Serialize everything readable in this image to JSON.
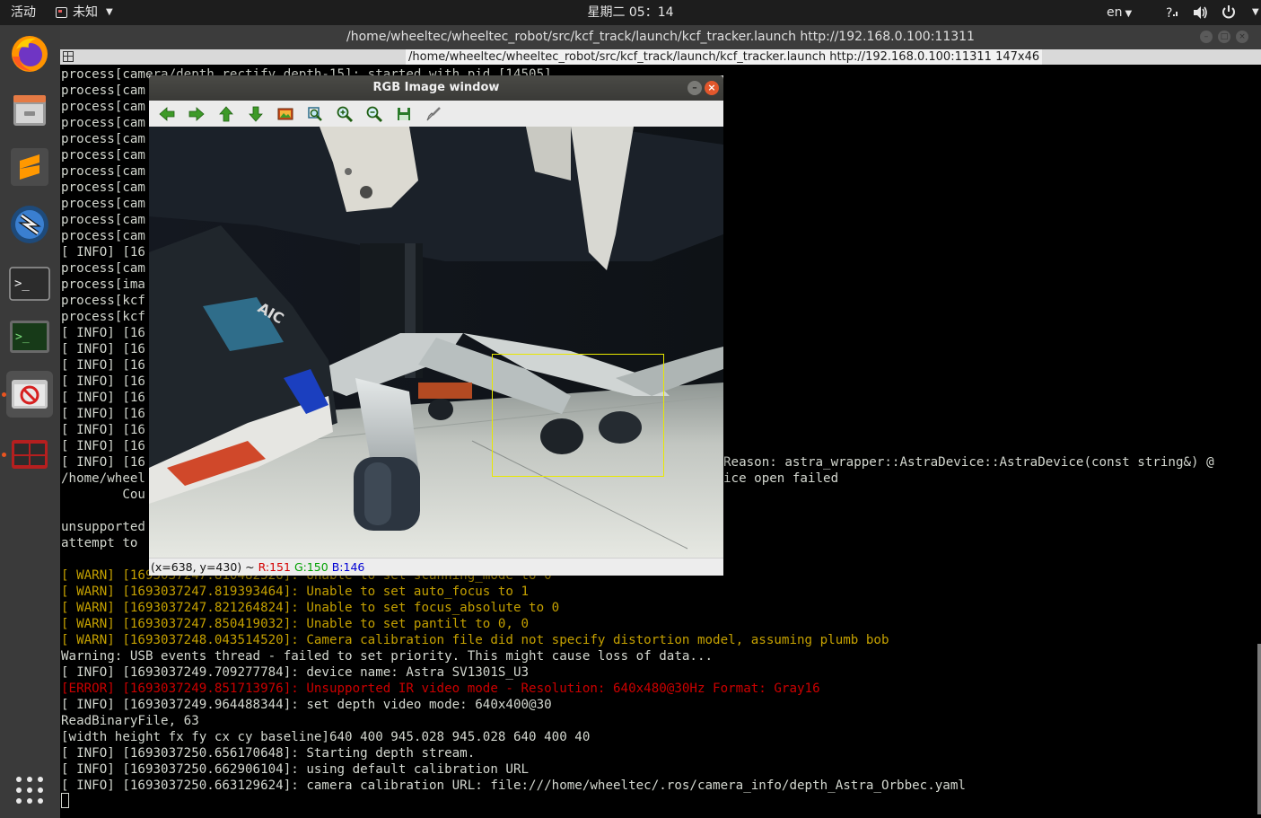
{
  "topbar": {
    "activities": "活动",
    "app_menu": "未知",
    "clock": "星期二 05：14",
    "lang": "en",
    "tray_icons": [
      "accessibility-icon",
      "volume-icon",
      "power-icon"
    ]
  },
  "dock": {
    "items": [
      "firefox",
      "files",
      "sublime-text",
      "remote-desktop",
      "terminal",
      "system-monitor",
      "camera-app",
      "screen-tool"
    ],
    "show_apps_icon": "app-grid-icon"
  },
  "terminal": {
    "window_title": "/home/wheeltec/wheeltec_robot/src/kcf_track/launch/kcf_tracker.launch http://192.168.0.100:11311",
    "tab_title": "/home/wheeltec/wheeltec_robot/src/kcf_track/launch/kcf_tracker.launch http://192.168.0.100:11311 147x46",
    "partial_lines": [
      "process[cam",
      "process[cam",
      "process[cam",
      "process[cam",
      "process[cam",
      "process[cam",
      "process[cam",
      "process[cam",
      "process[cam",
      "process[cam",
      "[ INFO] [16",
      "process[cam",
      "process[ima",
      "process[kcf",
      "process[kcf",
      "[ INFO] [16",
      "[ INFO] [16",
      "[ INFO] [16",
      "[ INFO] [16",
      "[ INFO] [16",
      "[ INFO] [16",
      "[ INFO] [16",
      "[ INFO] [16",
      "[ INFO] [16",
      "/home/wheel",
      "        Cou",
      "",
      "unsupported",
      "attempt to"
    ],
    "first_line": "process[camera/depth_rectify_depth-15]: started with pid [14505]",
    "right_fragments": {
      "reason": "Reason: astra_wrapper::AstraDevice::AstraDevice(const string&) @",
      "device_open": "ice open failed"
    },
    "lines": [
      {
        "kind": "warn",
        "text": "[ WARN] [1693037247.810482526]: Unable to set scanning_mode to 0"
      },
      {
        "kind": "warn",
        "text": "[ WARN] [1693037247.819393464]: Unable to set auto_focus to 1"
      },
      {
        "kind": "warn",
        "text": "[ WARN] [1693037247.821264824]: Unable to set focus_absolute to 0"
      },
      {
        "kind": "warn",
        "text": "[ WARN] [1693037247.850419032]: Unable to set pantilt to 0, 0"
      },
      {
        "kind": "warn",
        "text": "[ WARN] [1693037248.043514520]: Camera calibration file did not specify distortion model, assuming plumb bob"
      },
      {
        "kind": "normal",
        "text": "Warning: USB events thread - failed to set priority. This might cause loss of data..."
      },
      {
        "kind": "normal",
        "text": "[ INFO] [1693037249.709277784]: device name: Astra SV1301S_U3"
      },
      {
        "kind": "error",
        "text": "[ERROR] [1693037249.851713976]: Unsupported IR video mode - Resolution: 640x480@30Hz Format: Gray16"
      },
      {
        "kind": "normal",
        "text": "[ INFO] [1693037249.964488344]: set depth video mode: 640x400@30"
      },
      {
        "kind": "normal",
        "text": "ReadBinaryFile, 63"
      },
      {
        "kind": "normal",
        "text": "[width height fx fy cx cy baseline]640 400 945.028 945.028 640 400 40"
      },
      {
        "kind": "normal",
        "text": "[ INFO] [1693037250.656170648]: Starting depth stream."
      },
      {
        "kind": "normal",
        "text": "[ INFO] [1693037250.662906104]: using default calibration URL"
      },
      {
        "kind": "normal",
        "text": "[ INFO] [1693037250.663129624]: camera calibration URL: file:///home/wheeltec/.ros/camera_info/depth_Astra_Orbbec.yaml"
      }
    ]
  },
  "rgb_window": {
    "title": "RGB Image window",
    "toolbar": [
      "arrow-left-icon",
      "arrow-right-icon",
      "arrow-up-icon",
      "arrow-down-icon",
      "image-icon",
      "zoom-fit-icon",
      "zoom-in-icon",
      "zoom-out-icon",
      "save-icon",
      "brush-icon"
    ],
    "image_text": "AIC",
    "status": {
      "coords": "(x=638, y=430) ~ ",
      "r": "R:151",
      "g": "G:150",
      "b": "B:146"
    }
  }
}
